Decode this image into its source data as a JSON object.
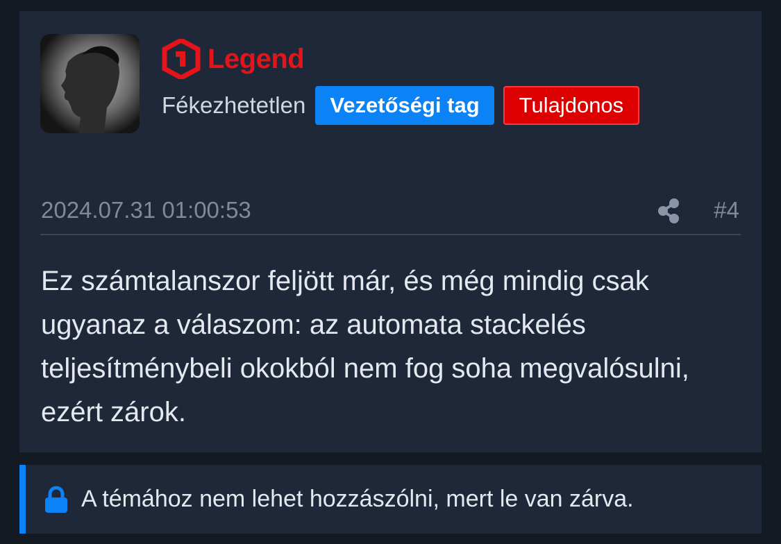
{
  "post": {
    "author": {
      "avatar_icon": "profile-photo",
      "rank_label": "Legend",
      "rank_icon": "legend-logo-icon",
      "rank_color": "#e5141a",
      "username": "Fékezhetetlen",
      "badges": [
        {
          "label": "Vezetőségi tag",
          "color": "#0b82f5"
        },
        {
          "label": "Tulajdonos",
          "color": "#dd0000"
        }
      ]
    },
    "timestamp": "2024.07.31 01:00:53",
    "share_icon": "share-icon",
    "post_number": "#4",
    "body": "Ez számtalanszor feljött már, és még mindig csak ugyanaz a válaszom: az automata stackelés teljesítménybeli okokból nem fog soha megvalósulni, ezért zárok."
  },
  "notice": {
    "icon": "lock-icon",
    "text": "A témához nem lehet hozzászólni, mert le van zárva.",
    "accent_color": "#0b82f5"
  }
}
